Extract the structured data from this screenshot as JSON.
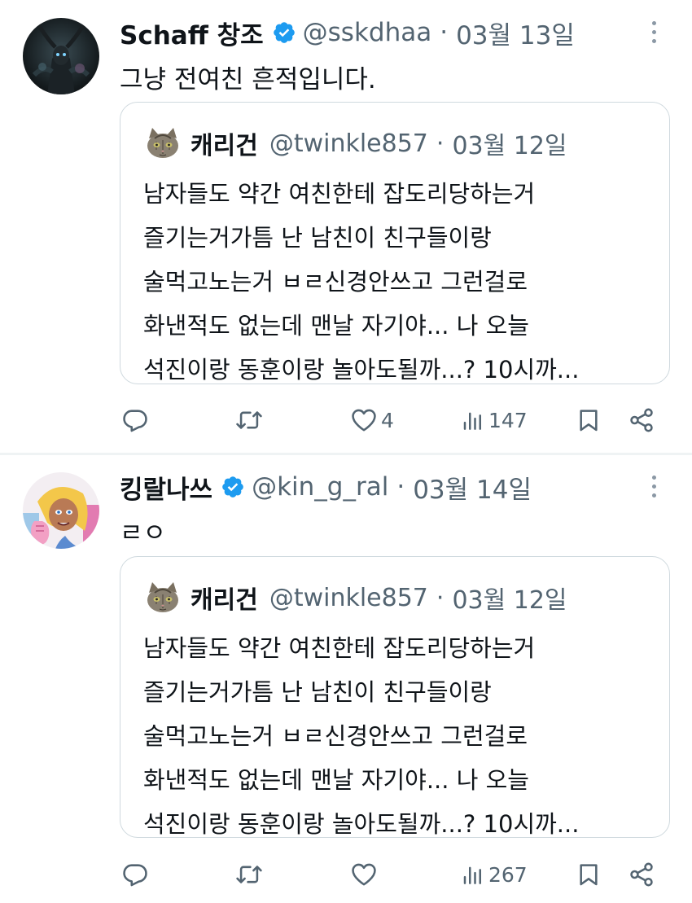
{
  "tweets": [
    {
      "author": {
        "name": "Schaff 창조",
        "handle": "@sskdhaa",
        "date": "03월 13일",
        "verified": true,
        "avatar": "dark-creature-avatar"
      },
      "text": "그냥 전여친 흔적입니다.",
      "quote": {
        "author": {
          "name": "캐리건",
          "handle": "@twinkle857",
          "date": "03월 12일",
          "avatar": "cat-avatar"
        },
        "lines": [
          "남자들도 약간 여친한테 잡도리당하는거",
          "즐기는거가틈 난 남친이 친구들이랑",
          "술먹고노는거 ㅂㄹ신경안쓰고 그런걸로",
          "화낸적도 없는데 맨날 자기야... 나 오늘",
          "석진이랑 동훈이랑 놀아도될까...? 10시까..."
        ]
      },
      "actions": {
        "reply": "",
        "retweet": "",
        "like": "4",
        "views": "147"
      }
    },
    {
      "author": {
        "name": "킹랄나쓰",
        "handle": "@kin_g_ral",
        "date": "03월 14일",
        "verified": true,
        "avatar": "anime-girl-avatar"
      },
      "text": "ㄹㅇ",
      "quote": {
        "author": {
          "name": "캐리건",
          "handle": "@twinkle857",
          "date": "03월 12일",
          "avatar": "cat-avatar"
        },
        "lines": [
          "남자들도 약간 여친한테 잡도리당하는거",
          "즐기는거가틈 난 남친이 친구들이랑",
          "술먹고노는거 ㅂㄹ신경안쓰고 그런걸로",
          "화낸적도 없는데 맨날 자기야... 나 오늘",
          "석진이랑 동훈이랑 놀아도될까...? 10시까..."
        ]
      },
      "actions": {
        "reply": "",
        "retweet": "",
        "like": "",
        "views": "267"
      }
    }
  ],
  "colors": {
    "text": "#0f1419",
    "secondary": "#536471",
    "verified": "#1d9bf0",
    "border": "#cfd9de"
  }
}
